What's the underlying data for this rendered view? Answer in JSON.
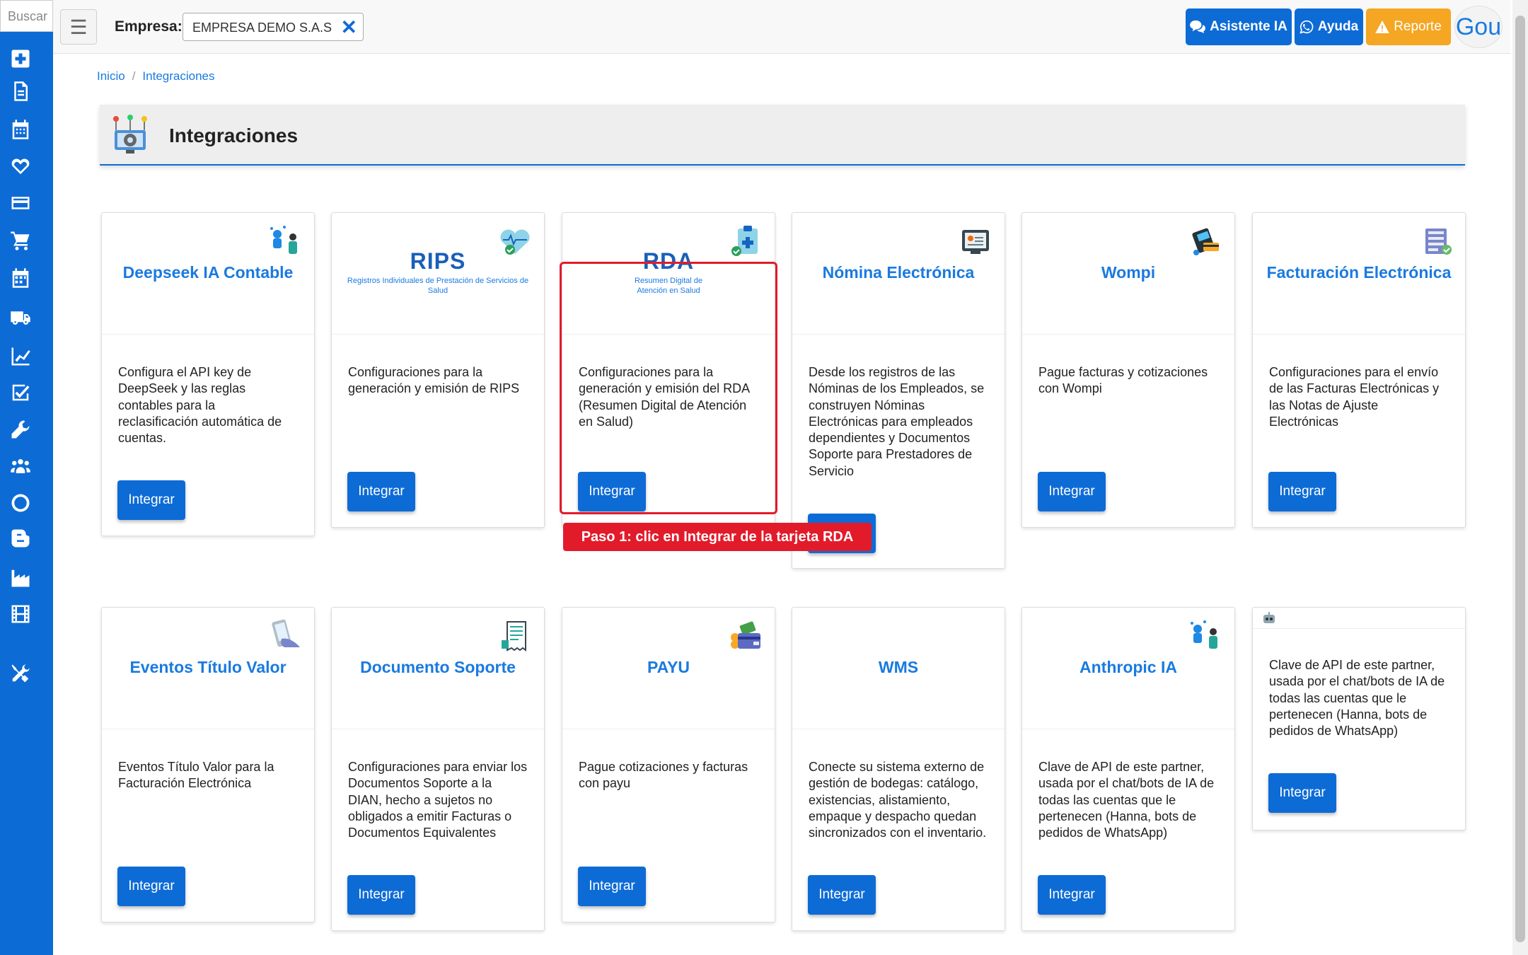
{
  "sidebar": {
    "search_placeholder": "Buscar",
    "icons": [
      "plus-square-icon",
      "rips-file-icon",
      "calendar-icon",
      "heart-icon",
      "credit-card-icon",
      "cart-icon",
      "calendar-grid-icon",
      "truck-icon",
      "line-chart-icon",
      "checkbox-icon",
      "wrench-icon",
      "users-icon",
      "circle-icon",
      "blogger-icon",
      "industry-icon",
      "film-icon",
      "tools-icon"
    ]
  },
  "topbar": {
    "empresa_label": "Empresa:",
    "empresa_value": "EMPRESA DEMO S.A.S",
    "asistente_label": "Asistente IA",
    "ayuda_label": "Ayuda",
    "reporte_label": "Reporte",
    "avatar_text": "Gou"
  },
  "breadcrumb": {
    "home": "Inicio",
    "current": "Integraciones"
  },
  "page": {
    "title": "Integraciones"
  },
  "cards": [
    {
      "title": "Deepseek IA Contable",
      "desc": "Configura el API key de DeepSeek y las reglas contables para la reclasificación automática de cuentas.",
      "button": "Integrar"
    },
    {
      "logo_big": "RIPS",
      "logo_small": "Registros Individuales de Prestación de Servicios de Salud",
      "desc": "Configuraciones para la generación y emisión de RIPS",
      "button": "Integrar"
    },
    {
      "logo_big": "RDA",
      "logo_small": "Resumen Digital de Atención en Salud",
      "desc": "Configuraciones para la generación y emisión del RDA (Resumen Digital de Atención en Salud)",
      "button": "Integrar"
    },
    {
      "title": "Nómina Electrónica",
      "desc": "Desde los registros de las Nóminas de los Empleados, se construyen Nóminas Electrónicas para empleados dependientes y Documentos Soporte para Prestadores de Servicio",
      "button": "Integrar"
    },
    {
      "title": "Wompi",
      "desc": "Pague facturas y cotizaciones con Wompi",
      "button": "Integrar"
    },
    {
      "title": "Facturación Electrónica",
      "desc": "Configuraciones para el envío de las Facturas Electrónicas y las Notas de Ajuste Electrónicas",
      "button": "Integrar"
    },
    {
      "title": "Eventos Título Valor",
      "desc": "Eventos Título Valor para la Facturación Electrónica",
      "button": "Integrar"
    },
    {
      "title": "Documento Soporte",
      "desc": "Configuraciones para enviar los Documentos Soporte a la DIAN, hecho a sujetos no obligados a emitir Facturas o Documentos Equivalentes",
      "button": "Integrar"
    },
    {
      "title": "PAYU",
      "desc": "Pague cotizaciones y facturas con payu",
      "button": "Integrar"
    },
    {
      "title": "WMS",
      "desc": "Conecte su sistema externo de gestión de bodegas: catálogo, existencias, alistamiento, empaque y despacho quedan sincronizados con el inventario.",
      "button": "Integrar"
    },
    {
      "title": "Anthropic IA",
      "desc": "Clave de API de este partner, usada por el chat/bots de IA de todas las cuentas que le pertenecen (Hanna, bots de pedidos de WhatsApp)",
      "button": "Integrar"
    },
    {
      "desc": "Clave de API de este partner, usada por el chat/bots de IA de todas las cuentas que le pertenecen (Hanna, bots de pedidos de WhatsApp)",
      "button": "Integrar"
    }
  ],
  "annotation": {
    "callout": "Paso 1: clic en Integrar de la tarjeta RDA"
  },
  "colors": {
    "primary": "#0d6bd6",
    "warning": "#f5a623",
    "highlight": "#e21b2b"
  }
}
